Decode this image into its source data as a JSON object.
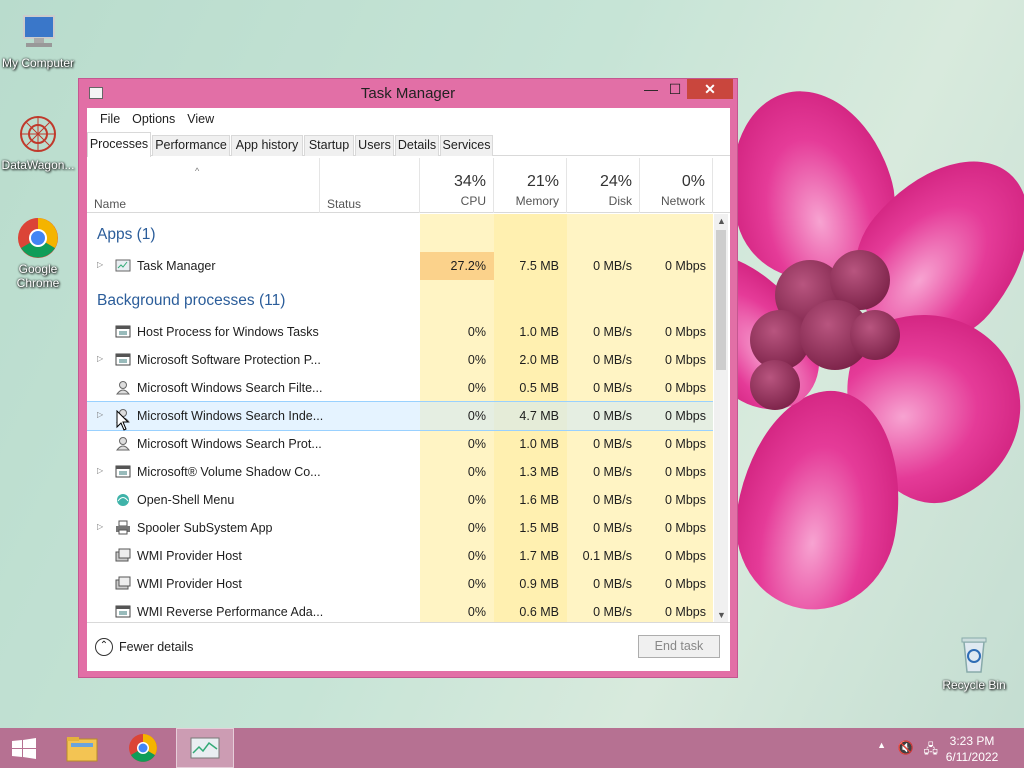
{
  "desktop": {
    "icons": [
      {
        "label": "My Computer",
        "icon": "computer-icon"
      },
      {
        "label": "DataWagon...",
        "icon": "datawagon-icon"
      },
      {
        "label": "Google Chrome",
        "icon": "chrome-icon"
      },
      {
        "label": "Recycle Bin",
        "icon": "recycle-bin-icon"
      }
    ]
  },
  "window": {
    "title": "Task Manager",
    "controls": {
      "minimize": "—",
      "maximize": "☐",
      "close": "✕"
    },
    "menu": [
      "File",
      "Options",
      "View"
    ],
    "tabs": [
      "Processes",
      "Performance",
      "App history",
      "Startup",
      "Users",
      "Details",
      "Services"
    ],
    "active_tab": "Processes",
    "columns": {
      "name": "Name",
      "status": "Status",
      "cpu": {
        "pct": "34%",
        "label": "CPU"
      },
      "memory": {
        "pct": "21%",
        "label": "Memory"
      },
      "disk": {
        "pct": "24%",
        "label": "Disk"
      },
      "network": {
        "pct": "0%",
        "label": "Network"
      }
    },
    "sort_indicator": "^",
    "groups": {
      "apps": "Apps (1)",
      "background": "Background processes (11)"
    },
    "apps": [
      {
        "name": "Task Manager",
        "cpu": "27.2%",
        "memory": "7.5 MB",
        "disk": "0 MB/s",
        "network": "0 Mbps",
        "expandable": true,
        "icon": "task-manager-icon"
      }
    ],
    "background": [
      {
        "name": "Host Process for Windows Tasks",
        "cpu": "0%",
        "memory": "1.0 MB",
        "disk": "0 MB/s",
        "network": "0 Mbps",
        "expandable": false,
        "icon": "window-app-icon"
      },
      {
        "name": "Microsoft Software Protection P...",
        "cpu": "0%",
        "memory": "2.0 MB",
        "disk": "0 MB/s",
        "network": "0 Mbps",
        "expandable": true,
        "icon": "window-app-icon"
      },
      {
        "name": "Microsoft Windows Search Filte...",
        "cpu": "0%",
        "memory": "0.5 MB",
        "disk": "0 MB/s",
        "network": "0 Mbps",
        "expandable": false,
        "icon": "search-user-icon"
      },
      {
        "name": "Microsoft Windows Search Inde...",
        "cpu": "0%",
        "memory": "4.7 MB",
        "disk": "0 MB/s",
        "network": "0 Mbps",
        "expandable": true,
        "icon": "search-user-icon",
        "selected": true
      },
      {
        "name": "Microsoft Windows Search Prot...",
        "cpu": "0%",
        "memory": "1.0 MB",
        "disk": "0 MB/s",
        "network": "0 Mbps",
        "expandable": false,
        "icon": "search-user-icon"
      },
      {
        "name": "Microsoft® Volume Shadow Co...",
        "cpu": "0%",
        "memory": "1.3 MB",
        "disk": "0 MB/s",
        "network": "0 Mbps",
        "expandable": true,
        "icon": "window-app-icon"
      },
      {
        "name": "Open-Shell Menu",
        "cpu": "0%",
        "memory": "1.6 MB",
        "disk": "0 MB/s",
        "network": "0 Mbps",
        "expandable": false,
        "icon": "shell-icon"
      },
      {
        "name": "Spooler SubSystem App",
        "cpu": "0%",
        "memory": "1.5 MB",
        "disk": "0 MB/s",
        "network": "0 Mbps",
        "expandable": true,
        "icon": "printer-icon"
      },
      {
        "name": "WMI Provider Host",
        "cpu": "0%",
        "memory": "1.7 MB",
        "disk": "0.1 MB/s",
        "network": "0 Mbps",
        "expandable": false,
        "icon": "wmi-icon"
      },
      {
        "name": "WMI Provider Host",
        "cpu": "0%",
        "memory": "0.9 MB",
        "disk": "0 MB/s",
        "network": "0 Mbps",
        "expandable": false,
        "icon": "wmi-icon"
      },
      {
        "name": "WMI Reverse Performance Ada...",
        "cpu": "0%",
        "memory": "0.6 MB",
        "disk": "0 MB/s",
        "network": "0 Mbps",
        "expandable": false,
        "icon": "window-app-icon"
      }
    ],
    "footer": {
      "fewer_details": "Fewer details",
      "end_task": "End task"
    }
  },
  "taskbar": {
    "items": [
      "start-icon",
      "file-explorer-icon",
      "chrome-icon",
      "task-manager-icon"
    ],
    "time": "3:23 PM",
    "date": "6/11/2022"
  },
  "colors": {
    "accent": "#e26fa6",
    "taskbar": "#b67192",
    "cpu_highlight": "#fbd28b",
    "heat_light": "#fff4c4",
    "heat_mid": "#fff0b0",
    "group_text": "#2b5d9a"
  }
}
